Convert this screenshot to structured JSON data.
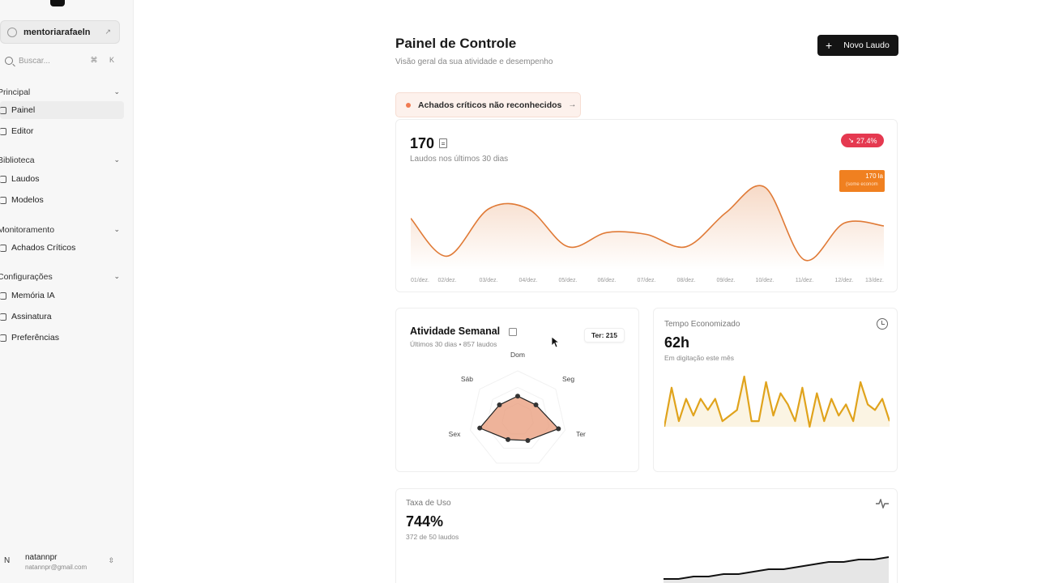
{
  "sidebar": {
    "workspace": "mentoriarafaeln",
    "search_placeholder": "Buscar...",
    "search_shortcut": "⌘ K",
    "sections": [
      {
        "title": "Principal",
        "items": [
          "Painel",
          "Editor"
        ]
      },
      {
        "title": "Biblioteca",
        "items": [
          "Laudos",
          "Modelos"
        ]
      },
      {
        "title": "Monitoramento",
        "items": [
          "Achados Críticos"
        ]
      },
      {
        "title": "Configurações",
        "items": [
          "Memória IA",
          "Assinatura",
          "Preferências"
        ]
      }
    ],
    "active_item": "Painel",
    "user": {
      "initial": "N",
      "name": "natannpr",
      "email": "natannpr@gmail.com"
    }
  },
  "header": {
    "title": "Painel de Controle",
    "subtitle": "Visão geral da sua atividade e desempenho",
    "new_button": "Novo Laudo"
  },
  "alert": {
    "text": "Achados críticos não reconhecidos"
  },
  "reports_card": {
    "value": "170",
    "label": "Laudos nos últimos 30 dias",
    "change_badge": "27.4%",
    "tooltip_value": "170 la",
    "tooltip_sub": "(some econom",
    "accent": "#e07a36"
  },
  "weekly_card": {
    "title": "Atividade Semanal",
    "subtitle": "Últimos 30 dias • 857 laudos",
    "highlight": "Ter: 215",
    "fill": "#e89a78"
  },
  "time_card": {
    "label": "Tempo Economizado",
    "value": "62h",
    "subtitle": "Em digitação este mês",
    "accent": "#e0a31c"
  },
  "usage_card": {
    "label": "Taxa de Uso",
    "value": "744%",
    "subtitle": "372 de 50 laudos"
  },
  "chart_data": [
    {
      "type": "area",
      "categories": [
        "01/dez.",
        "02/dez.",
        "03/dez.",
        "04/dez.",
        "05/dez.",
        "06/dez.",
        "07/dez.",
        "08/dez.",
        "09/dez.",
        "10/dez.",
        "11/dez.",
        "12/dez.",
        "13/dez."
      ],
      "values": [
        5,
        1,
        6,
        6,
        2,
        3.5,
        3.3,
        2,
        5.6,
        8.3,
        0.6,
        4.5,
        4.2
      ]
    },
    {
      "type": "radar",
      "categories": [
        "Dom",
        "Seg",
        "Ter",
        "Qua",
        "Qui",
        "Sex",
        "Sáb"
      ],
      "values": [
        120,
        120,
        215,
        120,
        115,
        200,
        120
      ]
    },
    {
      "type": "area",
      "values": [
        0,
        7,
        1,
        5,
        2,
        5,
        3,
        5,
        1,
        2,
        3,
        9,
        1,
        1,
        8,
        2,
        6,
        4,
        1,
        7,
        0,
        6,
        1,
        5,
        2,
        4,
        1,
        8,
        4,
        3,
        5,
        1
      ]
    },
    {
      "type": "area",
      "values": [
        1,
        1,
        2,
        2,
        3,
        3,
        4,
        5,
        5,
        6,
        7,
        8,
        8,
        9,
        9,
        10
      ]
    }
  ]
}
